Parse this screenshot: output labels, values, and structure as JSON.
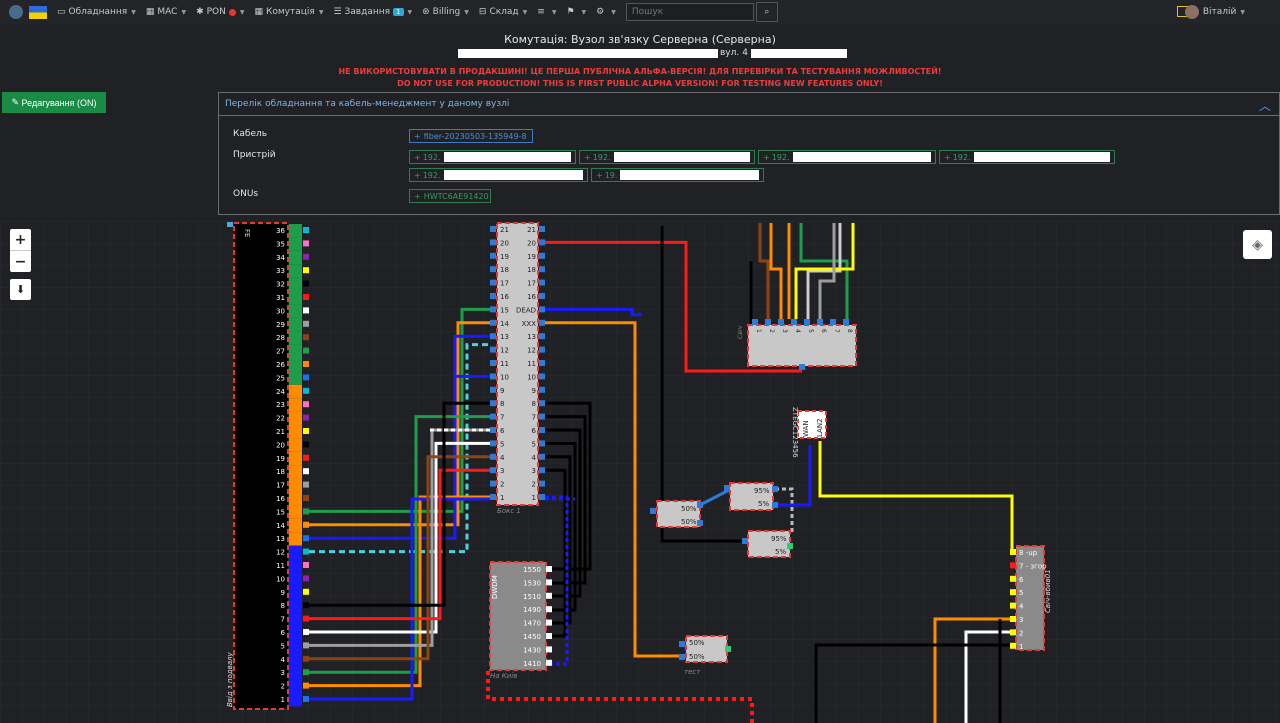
{
  "nav": {
    "items": [
      {
        "icon": "equipment-icon",
        "label": "Обладнання"
      },
      {
        "icon": "grid-icon",
        "label": "MAC"
      },
      {
        "icon": "pon-icon",
        "label": "PON"
      },
      {
        "icon": "grid-icon",
        "label": "Комутація"
      },
      {
        "icon": "list-icon",
        "label": "Завдання",
        "badge": "1"
      },
      {
        "icon": "billing-icon",
        "label": "Billing"
      },
      {
        "icon": "warehouse-icon",
        "label": "Склад"
      }
    ],
    "search_placeholder": "Пошук",
    "user_name": "Віталій",
    "pon_status_color": "#e53935"
  },
  "header": {
    "title": "Комутація: Вузол зв'язку Серверна (Серверна)",
    "street_label": "вул.",
    "house_prefix": "4",
    "warning_ua": "НЕ ВИКОРИСТОВУВАТИ В ПРОДАКШИНІ! ЦЕ ПЕРША ПУБЛІЧНА АЛЬФА-ВЕРСІЯ! ДЛЯ ПЕРЕВІРКИ ТА ТЕСТУВАННЯ МОЖЛИВОСТЕЙ!",
    "warning_en": "DO NOT USE FOR PRODUCTION! THIS IS FIRST PUBLIC ALPHA VERSION! FOR TESTING NEW FEATURES ONLY!"
  },
  "edit_button": "Редагування (ON)",
  "panel": {
    "title": "Перелік обладнання та кабель-менеджмент у даному вузлі",
    "cable_label": "Кабель",
    "cable_items": [
      "fiber-20230503-135949-8"
    ],
    "device_label": "Пристрій",
    "device_items": [
      "192.",
      "192.",
      "192.",
      "192.",
      "192.",
      "19."
    ],
    "onu_label": "ONUs",
    "onu_items": [
      "HWTC6AE91420"
    ]
  },
  "diagram": {
    "cable_caption": "Ввід з подвалу",
    "cable_top_label": "FE",
    "cable_fibers": [
      "36",
      "35",
      "34",
      "33",
      "32",
      "31",
      "30",
      "29",
      "28",
      "27",
      "26",
      "25",
      "24",
      "23",
      "22",
      "21",
      "20",
      "19",
      "18",
      "17",
      "16",
      "15",
      "14",
      "13",
      "12",
      "11",
      "10",
      "9",
      "8",
      "7",
      "6",
      "5",
      "4",
      "3",
      "2",
      "1"
    ],
    "box_caption": "Бокс 1",
    "box_rows": [
      "21",
      "20",
      "19",
      "18",
      "17",
      "16",
      "15",
      "14",
      "13",
      "12",
      "11",
      "10",
      "9",
      "8",
      "7",
      "6",
      "5",
      "4",
      "3",
      "2",
      "1"
    ],
    "box_mid_labels": {
      "15": "DEAD",
      "14": "XXX"
    },
    "dwdm_title": "DWDM",
    "dwdm_caption": "На Київ",
    "dwdm_channels": [
      "1550",
      "1530",
      "1510",
      "1490",
      "1470",
      "1450",
      "1430",
      "1410"
    ],
    "splitter_a": [
      "50%",
      "50%"
    ],
    "splitter_b": [
      "95%",
      "5%"
    ],
    "splitter_c": [
      "95%",
      "5%"
    ],
    "splitter_d": [
      "50%",
      "50%"
    ],
    "splitter_d_caption": "тест",
    "onu_label": "ZTEGC123456",
    "onu_ports": [
      "WAN",
      "LAN2"
    ],
    "switch_ports": [
      "8 -up",
      "7 - згор",
      "6",
      "5",
      "4",
      "3",
      "2",
      "1"
    ],
    "switch_caption": "Свіч-вбив01",
    "top_switch_caption": "Свіч"
  }
}
